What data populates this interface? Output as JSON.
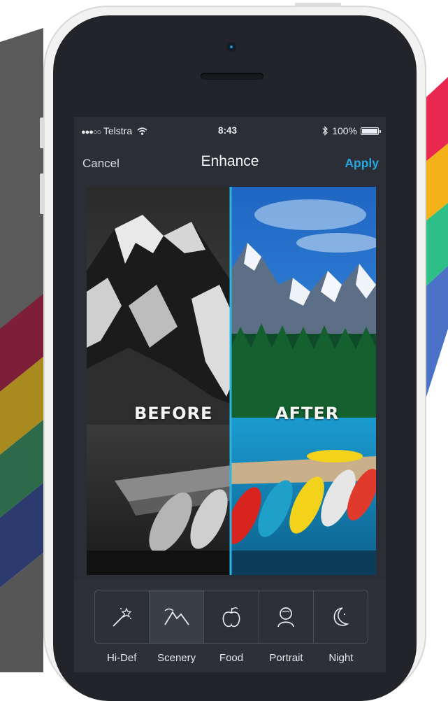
{
  "status_bar": {
    "carrier": "Telstra",
    "signal_icon": "signal-dots-icon",
    "wifi_icon": "wifi-icon",
    "time": "8:43",
    "bluetooth_icon": "bluetooth-icon",
    "battery": "100%",
    "battery_icon": "battery-icon"
  },
  "nav": {
    "cancel_label": "Cancel",
    "title": "Enhance",
    "apply_label": "Apply",
    "apply_color": "#28a7dc"
  },
  "preview": {
    "before_label": "BEFORE",
    "after_label": "AFTER",
    "divider_color": "#2cb6e6"
  },
  "tools": [
    {
      "icon": "magic-wand-icon",
      "label": "Hi-Def"
    },
    {
      "icon": "mountains-icon",
      "label": "Scenery"
    },
    {
      "icon": "fruit-icon",
      "label": "Food"
    },
    {
      "icon": "portrait-icon",
      "label": "Portrait"
    },
    {
      "icon": "moon-icon",
      "label": "Night"
    }
  ],
  "selected_tool": "Scenery",
  "decor_colors": {
    "stripes_right": [
      "#e8284f",
      "#f3b318",
      "#2ebf86",
      "#4b72c6"
    ],
    "stripes_left": [
      "#5a5a5a",
      "#7e1f3a",
      "#a88a1f",
      "#2d6a4a",
      "#2d3a6e"
    ]
  }
}
